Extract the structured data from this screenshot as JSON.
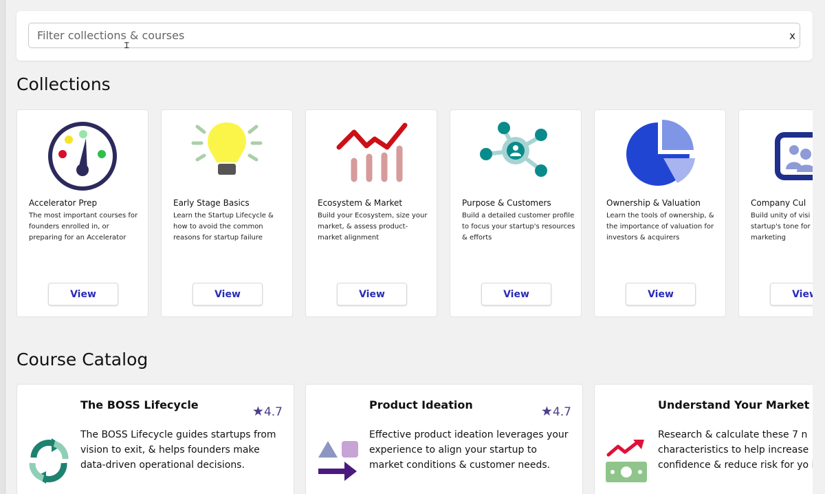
{
  "filter": {
    "placeholder": "Filter collections & courses",
    "clear_label": "x"
  },
  "sections": {
    "collections_title": "Collections",
    "catalog_title": "Course Catalog"
  },
  "collections": [
    {
      "title": "Accelerator Prep",
      "description": "The most important courses for founders enrolled in, or preparing for an Accelerator",
      "icon": "speedometer-icon",
      "button": "View"
    },
    {
      "title": "Early Stage Basics",
      "description": "Learn the Startup Lifecycle & how to avoid the common reasons for startup failure",
      "icon": "lightbulb-icon",
      "button": "View"
    },
    {
      "title": "Ecosystem & Market",
      "description": "Build your Ecosystem, size your market, & assess product-market alignment",
      "icon": "market-trend-icon",
      "button": "View"
    },
    {
      "title": "Purpose & Customers",
      "description": "Build a detailed customer profile to focus your startup's resources & efforts",
      "icon": "customer-network-icon",
      "button": "View"
    },
    {
      "title": "Ownership & Valuation",
      "description": "Learn the tools of ownership, & the importance of valuation for investors & acquirers",
      "icon": "pie-chart-icon",
      "button": "View"
    },
    {
      "title": "Company Cul",
      "description": "Build unity of visi startup's tone for marketing",
      "icon": "team-icon",
      "button": "View"
    }
  ],
  "courses": [
    {
      "title": "The BOSS Lifecycle",
      "rating": "4.7",
      "description": "The BOSS Lifecycle guides startups from vision to exit, & helps founders make data-driven operational decisions.",
      "icon": "cycle-arrows-icon"
    },
    {
      "title": "Product Ideation",
      "rating": "4.7",
      "description": "Effective product ideation leverages your experience to align your startup to market conditions & customer needs.",
      "icon": "shapes-arrow-icon"
    },
    {
      "title": "Understand Your Market",
      "rating": "",
      "description": "Research & calculate these 7 n characteristics to help increase confidence & reduce risk for yo investors.",
      "icon": "money-growth-icon"
    }
  ],
  "colors": {
    "button_text": "#2a2bb8",
    "rating": "#4a3f8c"
  }
}
